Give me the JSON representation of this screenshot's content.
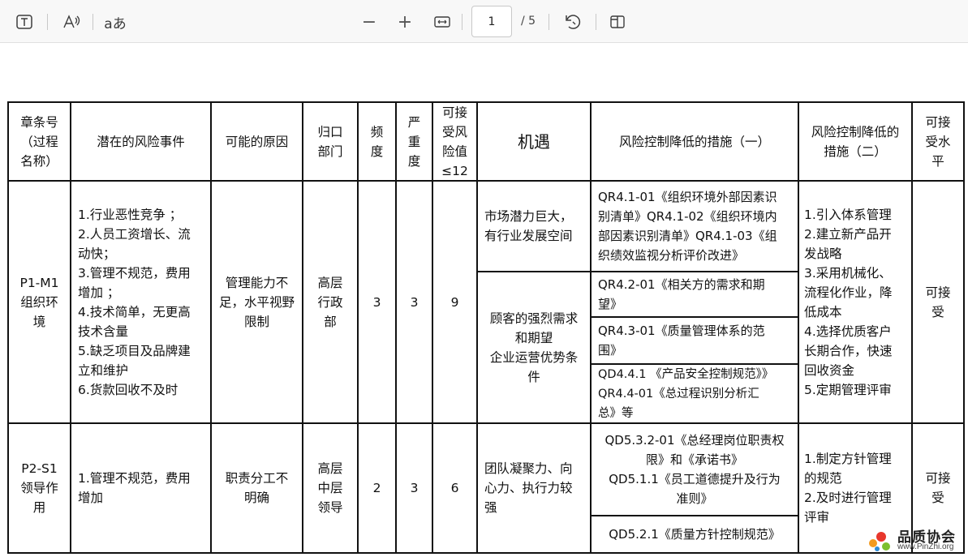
{
  "toolbar": {
    "text_tool_icon": "text-box-icon",
    "read_aloud_icon": "read-aloud-icon",
    "text_options_label": "aあ",
    "zoom_out_label": "−",
    "zoom_in_label": "+",
    "fit_width_icon": "fit-width-icon",
    "current_page": "1",
    "total_pages": "/ 5",
    "rotate_icon": "rotate-icon",
    "page_view_icon": "page-view-icon"
  },
  "table": {
    "headers": {
      "chapter": "章条号\n（过程\n名称）",
      "risk_event": "潜在的风险事件",
      "cause": "可能的原因",
      "department": "归口\n部门",
      "frequency": "频\n度",
      "severity": "严\n重\n度",
      "acceptable_value": "可接\n受风\n险值\n≤12",
      "opportunity": "机遇",
      "measures1": "风险控制降低的措施（一）",
      "measures2": "风险控制降低的\n措施（二）",
      "acceptable_level": "可接\n受水\n平"
    },
    "rows": [
      {
        "chapter": "P1-M1\n组织环\n境",
        "risk_event": "1.行业恶性竞争    ；\n2.人员工资增长、流\n动快；\n3.管理不规范，费用\n增加    ；\n4.技术简单，无更高\n技术含量\n5.缺乏项目及品牌建\n立和维护\n6.货款回收不及时",
        "cause": "管理能力不\n足，水平视野\n限制",
        "department": "高层\n行政\n部",
        "frequency": "3",
        "severity": "3",
        "value": "9",
        "opportunity_a": "市场潜力巨大，\n有行业发展空间",
        "opportunity_b": "顾客的强烈需求\n和期望\n企业运营优势条\n件",
        "measure_a": "QR4.1-01《组织环境外部因素识\n别清单》QR4.1-02《组织环境内\n部因素识别清单》QR4.1-03《组\n织绩效监视分析评价改进》",
        "measure_b": "QR4.2-01《相关方的需求和期\n望》",
        "measure_c": "QR4.3-01《质量管理体系的范\n围》",
        "measure_d": "QD4.4.1 《产品安全控制规范》》\nQR4.4-01《总过程识别分析汇\n总》等",
        "measures2": "1.引入体系管理\n2.建立新产品开\n发战略\n3.采用机械化、\n流程化作业，降\n低成本\n4.选择优质客户\n长期合作，快速\n回收资金\n5.定期管理评审",
        "acceptable": "可接\n受"
      },
      {
        "chapter": "P2-S1\n领导作\n用",
        "risk_event": "1.管理不规范，费用\n增加",
        "cause": "职责分工不\n明确",
        "department": "高层\n中层\n领导",
        "frequency": "2",
        "severity": "3",
        "value": "6",
        "opportunity": "团队凝聚力、向\n心力、执行力较\n强",
        "measure_a": "QD5.3.2-01《总经理岗位职责权\n限》和《承诺书》\nQD5.1.1《员工道德提升及行为\n准则》",
        "measure_b": "QD5.2.1《质量方针控制规范》",
        "measures2": "1.制定方针管理\n的规范\n2.及时进行管理\n评审",
        "acceptable": "可接\n受"
      }
    ]
  },
  "watermark": {
    "title": "品质协会",
    "url": "www.PinZhi.org",
    "logo_icon": "pinzhi-logo-icon"
  }
}
